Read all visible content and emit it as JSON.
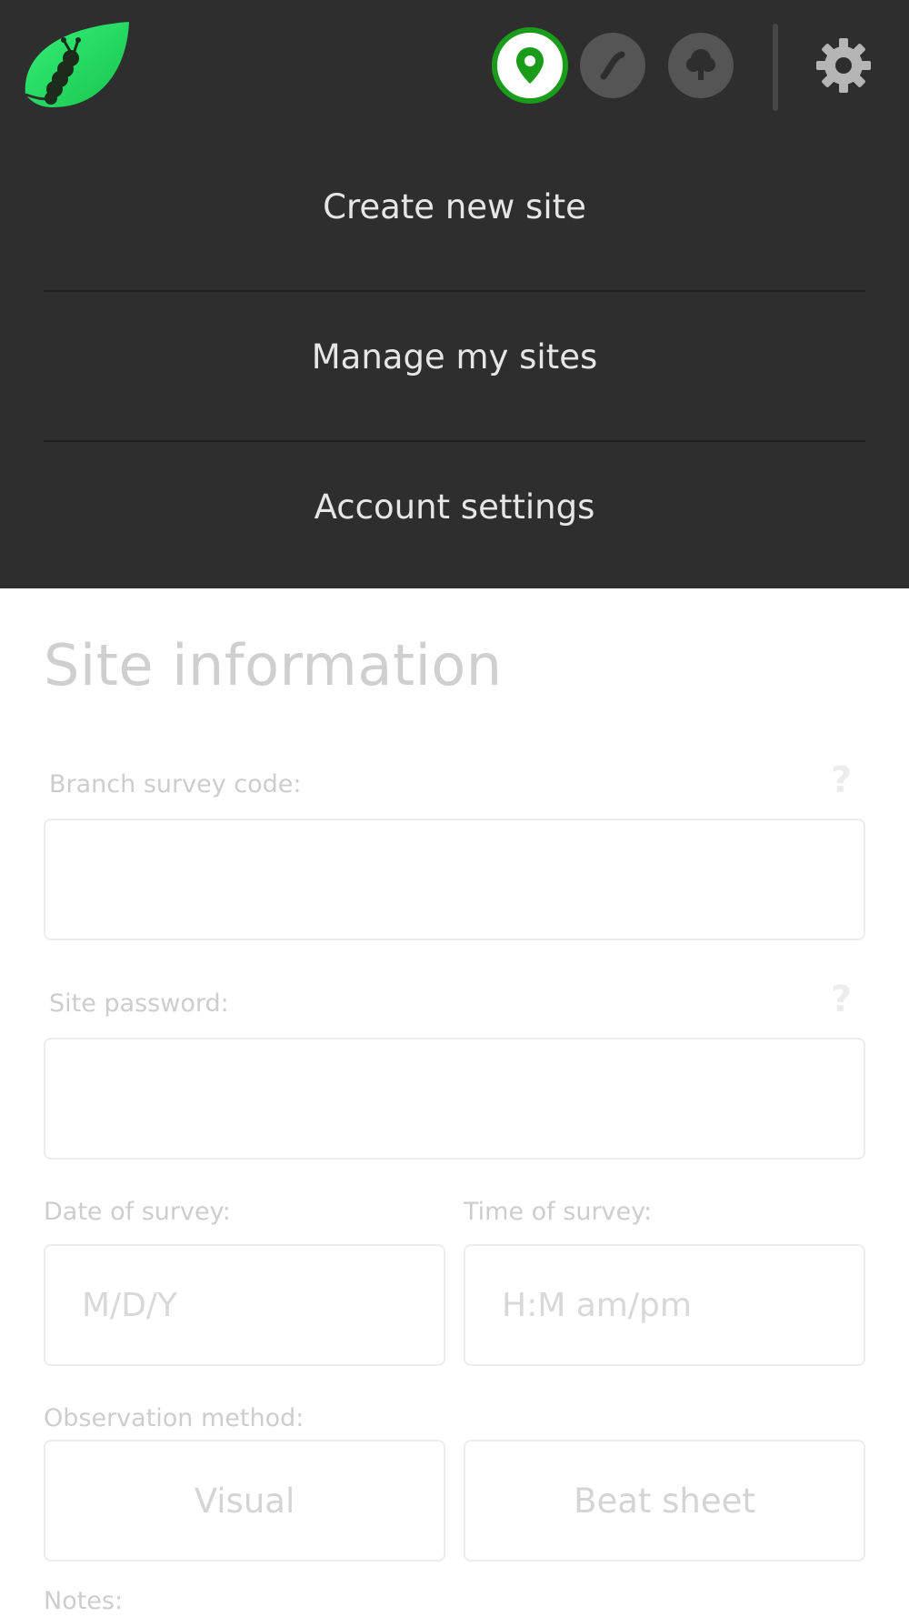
{
  "topbar": {
    "logo_icon": "leaf-caterpillar-logo",
    "nav_buttons": [
      {
        "icon": "map-pin-icon",
        "state": "active"
      },
      {
        "icon": "caterpillar-icon",
        "state": "inactive"
      },
      {
        "icon": "tree-icon",
        "state": "inactive"
      }
    ],
    "settings_icon": "gear-icon",
    "colors": {
      "bar": "#2e2e2e",
      "accent": "#1a9c1a",
      "logo_green": "#2ee06a"
    }
  },
  "menu": {
    "items": [
      {
        "label": "Create new site"
      },
      {
        "label": "Manage my sites"
      },
      {
        "label": "Account settings"
      }
    ]
  },
  "form": {
    "title": "Site information",
    "branch_code": {
      "label": "Branch survey code:",
      "value": "",
      "help": "?"
    },
    "site_password": {
      "label": "Site password:",
      "value": "",
      "help": "?"
    },
    "date": {
      "label": "Date of survey:",
      "placeholder": "M/D/Y"
    },
    "time": {
      "label": "Time of survey:",
      "placeholder": "H:M am/pm"
    },
    "observation": {
      "label": "Observation method:",
      "options": [
        "Visual",
        "Beat sheet"
      ]
    },
    "notes": {
      "label": "Notes:"
    }
  }
}
